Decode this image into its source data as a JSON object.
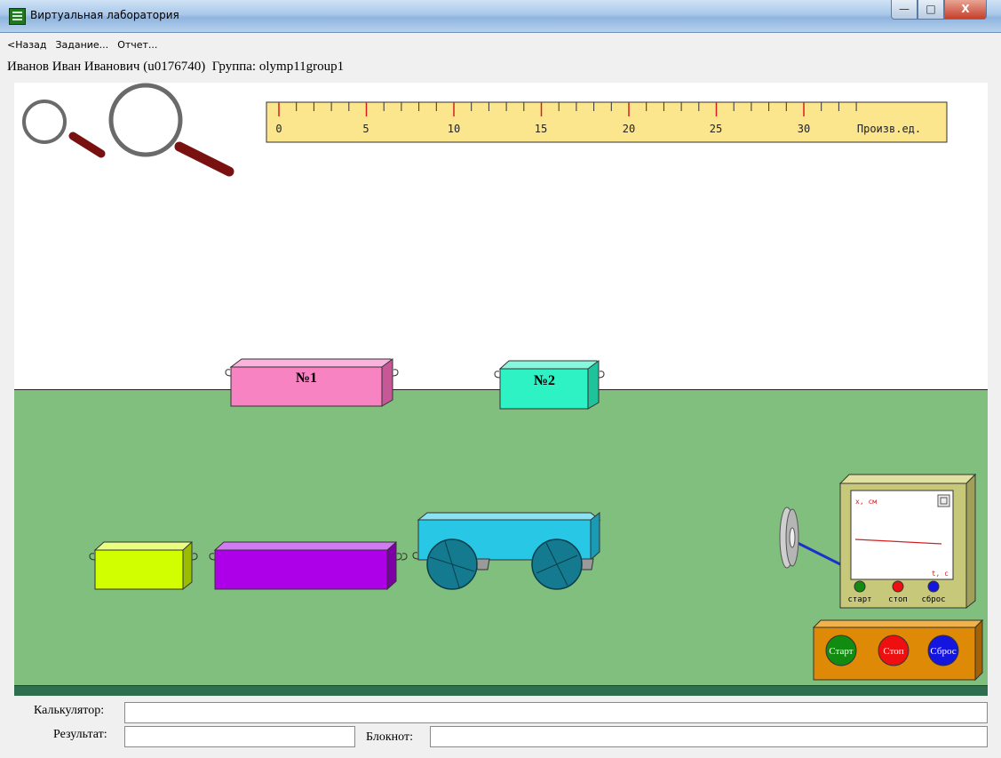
{
  "window": {
    "title": "Виртуальная лаборатория",
    "minimize_glyph": "—",
    "maximize_glyph": "□",
    "close_glyph": "X"
  },
  "menu": {
    "back": "<Назад",
    "task": "Задание...",
    "report": "Отчет..."
  },
  "user": {
    "info": "Иванов Иван Иванович (u0176740)",
    "group_label": "Группа:",
    "group": "olymp11group1"
  },
  "ruler": {
    "ticks": [
      "0",
      "5",
      "10",
      "15",
      "20",
      "25",
      "30"
    ],
    "unit": "Произв.ед."
  },
  "blocks": {
    "block1": "№1",
    "block2": "№2"
  },
  "scope": {
    "y_axis": "x, см",
    "x_axis": "t, с",
    "start": "старт",
    "stop": "стоп",
    "reset": "сброс"
  },
  "control": {
    "start": "Старт",
    "stop": "Стоп",
    "reset": "Сброс"
  },
  "bottom": {
    "calculator_label": "Калькулятор:",
    "calculator_value": "",
    "result_label": "Результат:",
    "result_value": "",
    "notepad_label": "Блокнот:",
    "notepad_value": ""
  },
  "colors": {
    "canvas_bg": "#ffffff",
    "ground": "#80bf7e",
    "ground_strip": "#2f6e4f",
    "ruler_bg": "#fbe58d",
    "block1": "#f783c3",
    "block2": "#2ff2c4",
    "yellow_block": "#d2ff00",
    "purple_block": "#ad00e8",
    "cart": "#29c7e6",
    "wheel": "#147a90",
    "scope_frame": "#c8c87b",
    "control_panel": "#de8a07",
    "btn_start": "#118c11",
    "btn_stop": "#ee1010",
    "btn_reset": "#1515e0"
  },
  "icons": {
    "zoom_out": "magnifier-small-icon",
    "zoom_in": "magnifier-large-icon",
    "app": "lab-app-icon",
    "detach": "window-icon"
  }
}
